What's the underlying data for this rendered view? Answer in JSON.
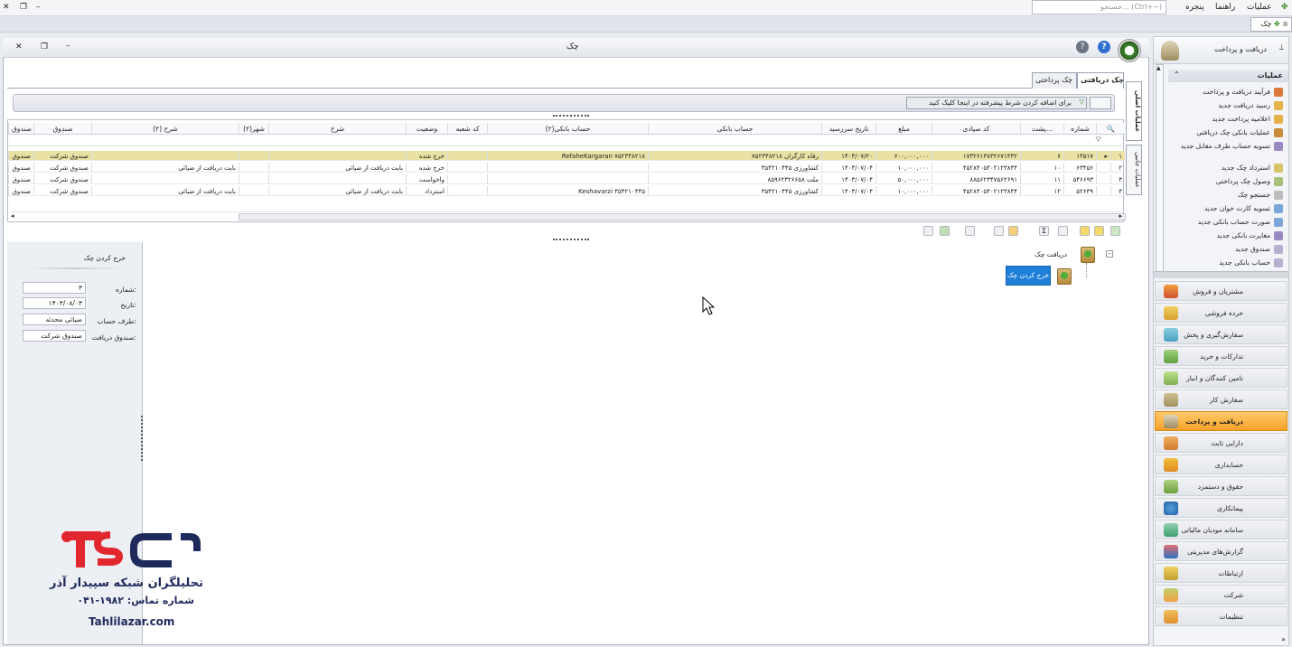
{
  "menubar": {
    "items": [
      "عملیات",
      "راهنما",
      "پنجره"
    ],
    "search_placeholder": "جستجو... (Ctrl+~)"
  },
  "doc_tab": "چک",
  "window": {
    "title": "چک"
  },
  "tabs": [
    "چک دریافتی",
    "چک پرداختی"
  ],
  "filter": {
    "button": "برای اضافه کردن شرط پیشرفته در اینجا کلیک کنید"
  },
  "grid": {
    "columns": [
      "شماره",
      "پشت...",
      "کد صیادی",
      "مبلغ",
      "تاریخ سررسید",
      "حساب بانکی",
      "حساب بانکی(۲)",
      "کد شعبه",
      "وضعیت",
      "شرح",
      "شهر(۲)",
      "شرح (۲)",
      "صندوق",
      "صندوق"
    ],
    "rows": [
      {
        "idx": "۱",
        "c": [
          "۱۳۵۱۷",
          "۶",
          "۱۷۳۲۶۱۳۸۳۲۶۷۱۳۳۲",
          "۶۰۰,۰۰۰,۰۰۰",
          "۱۴۰۳/۰۷/۲۰",
          "رفاه کارگران ۷۵۲۳۴۸۲۱۸",
          "RefaheKargaran ۷۵۲۳۴۸۲۱۸",
          "",
          "خرج شده",
          "",
          "",
          "",
          "صندوق شرکت",
          "صندوق"
        ]
      },
      {
        "idx": "۲",
        "c": [
          "۶۳۴۵۶",
          "۱۰",
          "۴۵۲۸۴۰۵۴۰۲۱۲۳۸۴۴",
          "۱۰,۰۰۰,۰۰۰",
          "۱۴۰۳/۰۷/۰۴",
          "کشاورزی ۳۵۴۲۱۰۴۴۵",
          "",
          "",
          "خرج شده",
          "بابت دریافت از ضیائی",
          "",
          "بابت دریافت از ضیائی",
          "صندوق شرکت",
          "صندوق"
        ]
      },
      {
        "idx": "۳",
        "c": [
          "۵۴۶۶۹۳",
          "۱۱",
          "۸۸۵۶۲۳۴۷۵۶۲۶۹۱",
          "۵۰,۰۰۰,۰۰۰",
          "۱۴۰۳/۰۷/۰۴",
          "ملت ۸۵۹۶۲۳۲۶۶۵۸",
          "",
          "",
          "واخواست",
          "",
          "",
          "",
          "صندوق شرکت",
          "صندوق"
        ]
      },
      {
        "idx": "۴",
        "c": [
          "۵۲۶۳۹",
          "۱۲",
          "۴۵۲۸۴۰۵۴۰۲۱۲۳۸۴۴",
          "۱۰,۰۰۰,۰۰۰",
          "۱۴۰۳/۰۷/۰۴",
          "کشاورزی ۳۵۴۲۱۰۴۴۵",
          "Keshavarzi ۳۵۴۲۱۰۴۴۵",
          "",
          "استرداد",
          "بابت دریافت از ضیائی",
          "",
          "بابت دریافت از ضیائی",
          "صندوق شرکت",
          "صندوق"
        ]
      }
    ]
  },
  "details": {
    "title": "خرج کردن چک",
    "fields": [
      {
        "label": "شماره:",
        "value": "۳"
      },
      {
        "label": "تاریخ:",
        "value": "۱۴۰۳/۰۸/۰۳"
      },
      {
        "label": "طرف حساب:",
        "value": "ضیائی محدثه"
      },
      {
        "label": "صندوق دریافت:",
        "value": "صندوق شرکت"
      }
    ]
  },
  "tree": {
    "root": "دریافت چک",
    "child": "خرج کردن چک"
  },
  "sidetabs": [
    "عملیات اصلی",
    "عملیات جانبی"
  ],
  "nav": {
    "title": "دریافت و پرداخت",
    "ops_header": "عملیات",
    "ops": [
      "فرآیند دریافت و پرداخت",
      "رسید دریافت جدید",
      "اعلامیه پرداخت جدید",
      "عملیات بانکی چک دریافتی",
      "تسویه حساب طرف مقابل جدید",
      "استرداد چک جدید",
      "وصول چک پرداختی",
      "جستجو چک",
      "تسویه کارت خوان جدید",
      "صورت حساب بانکی جدید",
      "مغایرت بانکی جدید",
      "صندوق جدید",
      "حساب بانکی جدید"
    ],
    "categories": [
      "مشتریان و فروش",
      "خرده فروشی",
      "سفارش‌گیری و پخش",
      "تدارکات و خرید",
      "تامین کنندگان و انبار",
      "سفارش کار",
      "دریافت و پرداخت",
      "دارایی ثابت",
      "حسابداری",
      "حقوق و دستمزد",
      "پیمانکاری",
      "سامانه مودیان مالیاتی",
      "گزارش‌های مدیریتی",
      "ارتباطات",
      "شرکت",
      "تنظیمات"
    ],
    "active_category": "دریافت و پرداخت"
  },
  "watermark": {
    "brand": "تحلیلگران شبکه سپیدار آذر",
    "phone": "شماره تماس: ۱۹۸۲-۰۴۱",
    "site": "Tahlilazar.com"
  },
  "colors": {
    "accent": "#f7a22a",
    "selected_row": "#e9e2a4",
    "brand_red": "#e2262e",
    "brand_navy": "#1f2a5c",
    "selected_node": "#1e7fd8"
  }
}
